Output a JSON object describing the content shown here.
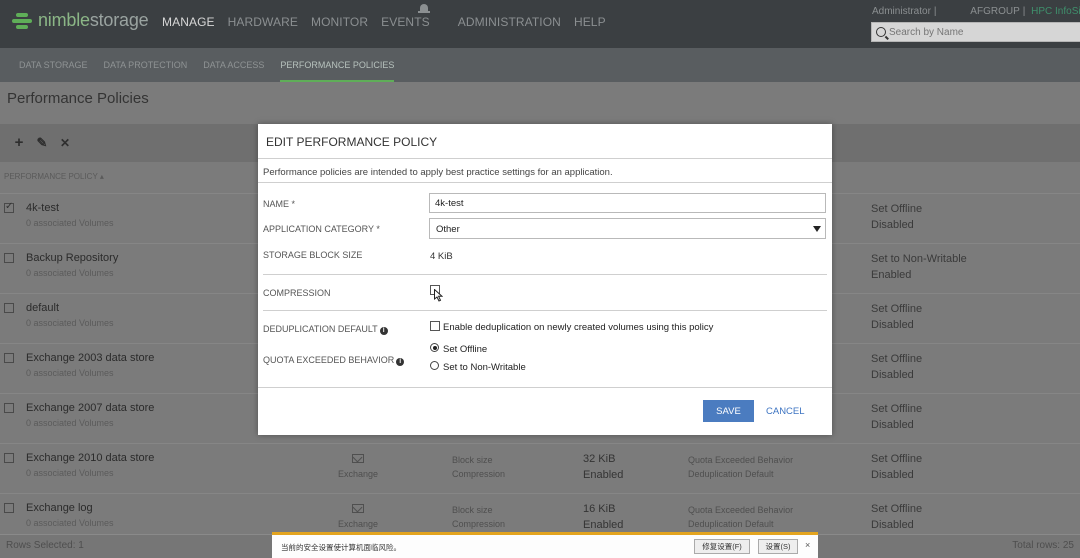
{
  "brand": {
    "name_part1": "nimble",
    "name_part2": "storage"
  },
  "main_nav": [
    "MANAGE",
    "HARDWARE",
    "MONITOR",
    "EVENTS",
    "ADMINISTRATION",
    "HELP"
  ],
  "user": {
    "name": "Administrator",
    "separator": "|",
    "org": "AFGROUP",
    "link": "HPC InfoSight"
  },
  "search": {
    "placeholder": "Search by Name"
  },
  "sub_nav": [
    "DATA STORAGE",
    "DATA PROTECTION",
    "DATA ACCESS",
    "PERFORMANCE POLICIES"
  ],
  "page": {
    "title": "Performance Policies",
    "column_header": "PERFORMANCE POLICY"
  },
  "toolbar": {
    "add": "+",
    "edit": "✎",
    "delete": "✕"
  },
  "rows": [
    {
      "name": "4k-test",
      "volumes": "0 associated Volumes",
      "quota1": "Set Offline",
      "quota2": "Disabled",
      "checked": true
    },
    {
      "name": "Backup Repository",
      "volumes": "0 associated Volumes",
      "quota1": "Set to Non-Writable",
      "quota2": "Enabled",
      "checked": false
    },
    {
      "name": "default",
      "volumes": "0 associated Volumes",
      "quota1": "Set Offline",
      "quota2": "Disabled",
      "checked": false
    },
    {
      "name": "Exchange 2003 data store",
      "volumes": "0 associated Volumes",
      "quota1": "Set Offline",
      "quota2": "Disabled",
      "checked": false
    },
    {
      "name": "Exchange 2007 data store",
      "volumes": "0 associated Volumes",
      "quota1": "Set Offline",
      "quota2": "Disabled",
      "checked": false
    },
    {
      "name": "Exchange 2010 data store",
      "volumes": "0 associated Volumes",
      "app": "Exchange",
      "label1": "Block size",
      "label2": "Compression",
      "val1": "32 KiB",
      "val2": "Enabled",
      "qlabel1": "Quota Exceeded Behavior",
      "qlabel2": "Deduplication Default",
      "quota1": "Set Offline",
      "quota2": "Disabled",
      "checked": false
    },
    {
      "name": "Exchange log",
      "volumes": "0 associated Volumes",
      "app": "Exchange",
      "label1": "Block size",
      "label2": "Compression",
      "val1": "16 KiB",
      "val2": "Enabled",
      "qlabel1": "Quota Exceeded Behavior",
      "qlabel2": "Deduplication Default",
      "quota1": "Set Offline",
      "quota2": "Disabled",
      "checked": false
    }
  ],
  "footer": {
    "selected": "Rows Selected: 1",
    "total": "Total rows: 25"
  },
  "modal": {
    "title": "EDIT PERFORMANCE POLICY",
    "description": "Performance policies are intended to apply best practice settings for an application.",
    "name_label": "NAME *",
    "name_value": "4k-test",
    "category_label": "APPLICATION CATEGORY *",
    "category_value": "Other",
    "block_size_label": "STORAGE BLOCK SIZE",
    "block_size_value": "4 KiB",
    "compression_label": "COMPRESSION",
    "dedup_label": "DEDUPLICATION DEFAULT",
    "dedup_text": "Enable deduplication on newly created volumes using this policy",
    "quota_label": "QUOTA EXCEEDED BEHAVIOR",
    "quota_options": [
      "Set Offline",
      "Set to Non-Writable"
    ],
    "info_glyph": "i",
    "save": "SAVE",
    "cancel": "CANCEL"
  },
  "security_bar": {
    "message": "当前的安全设置使计算机面临风险。",
    "fix_button": "修复设置(F)",
    "settings_button": "设置(S)",
    "close": "×"
  },
  "colors": {
    "accent_green": "#5fae58",
    "save_blue": "#4b7cc0",
    "warning_orange": "#e3a41f"
  }
}
